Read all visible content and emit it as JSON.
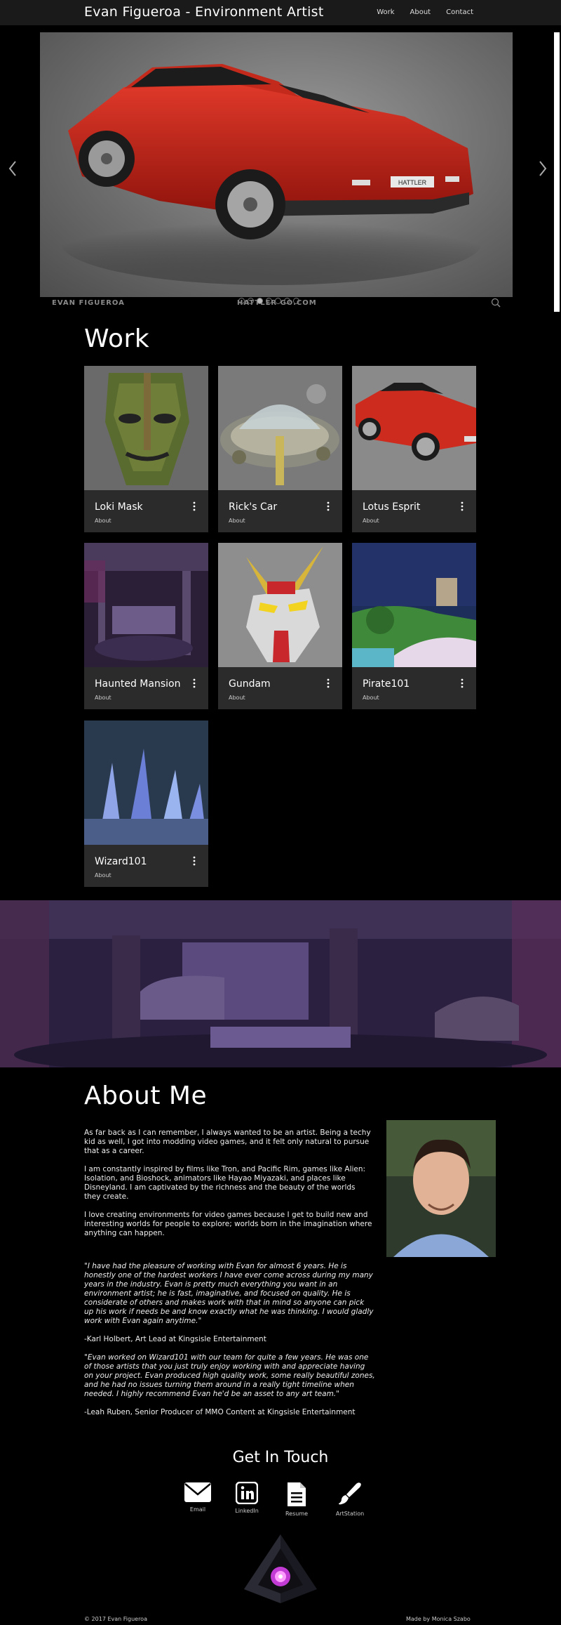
{
  "header": {
    "brand": "Evan Figueroa - Environment Artist",
    "nav": [
      "Work",
      "About",
      "Contact"
    ]
  },
  "hero": {
    "left_caption": "EVAN FIGUEROA",
    "mid_caption": "HATTLER GO.COM",
    "plate": "HATTLER",
    "slide_count": 7,
    "active_slide": 3,
    "icons": [
      "chevron-left-icon",
      "chevron-right-icon",
      "zoom-icon"
    ]
  },
  "work": {
    "title": "Work",
    "items": [
      {
        "title": "Loki Mask",
        "about": "About"
      },
      {
        "title": "Rick's Car",
        "about": "About"
      },
      {
        "title": "Lotus Esprit",
        "about": "About"
      },
      {
        "title": "Haunted Mansion",
        "about": "About"
      },
      {
        "title": "Gundam",
        "about": "About"
      },
      {
        "title": "Pirate101",
        "about": "About"
      },
      {
        "title": "Wizard101",
        "about": "About"
      }
    ]
  },
  "about": {
    "title": "About Me",
    "paragraphs": [
      "As far back as I can remember, I always wanted to be an artist. Being a techy kid as well, I got into modding video games, and it felt only natural to pursue that as a career.",
      "I am constantly inspired by films like Tron, and Pacific Rim, games like Alien: Isolation, and Bioshock, animators like Hayao Miyazaki, and places like Disneyland. I am captivated by the richness and the beauty of the worlds they create.",
      "I love creating environments for video games because I get to build new and interesting worlds for people to explore; worlds born in the imagination where anything can happen."
    ],
    "quotes": [
      {
        "text": "\"I have had the pleasure of working with Evan for almost 6 years. He is honestly one of the hardest workers I have ever come across during my many years in the industry. Evan is pretty much everything you want in an environment artist; he is fast, imaginative, and focused on quality. He is considerate of others and makes work with that in mind so anyone can pick up his work if needs be and know exactly what he was thinking. I would gladly work with Evan again anytime.\"",
        "author": "-Karl Holbert, Art Lead at Kingsisle Entertainment"
      },
      {
        "text": "\"Evan worked on Wizard101 with our team for quite a few years. He was one of those artists that you just truly enjoy working with and appreciate having on your project. Evan produced high quality work, some really beautiful zones, and he had no issues turning them around in a really tight timeline when needed. I highly recommend Evan he'd be an asset to any art team.\"",
        "author": "-Leah Ruben, Senior Producer of MMO Content at Kingsisle Entertainment"
      }
    ]
  },
  "contact": {
    "title": "Get In Touch",
    "items": [
      {
        "label": "Email",
        "icon": "envelope-icon"
      },
      {
        "label": "LinkedIn",
        "icon": "linkedin-icon"
      },
      {
        "label": "Resume",
        "icon": "document-icon"
      },
      {
        "label": "ArtStation",
        "icon": "paintbrush-icon"
      }
    ]
  },
  "footer": {
    "left": "© 2017 Evan Figueroa",
    "right": "Made by Monica Szabo"
  }
}
